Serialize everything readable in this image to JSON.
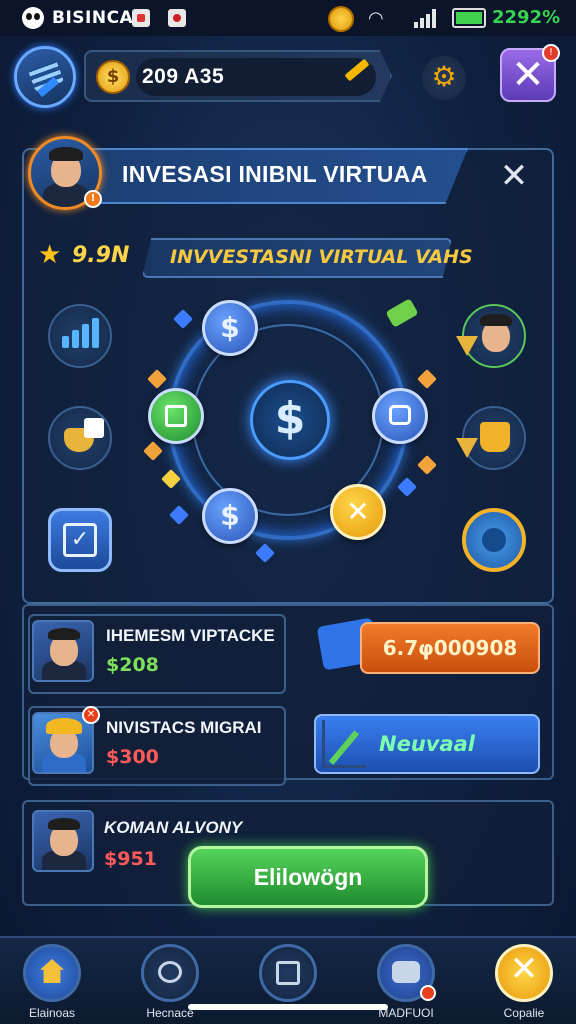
{
  "status_bar": {
    "carrier": "BISINCA",
    "battery_percent": "2292%",
    "battery_level": 1.0,
    "icons": [
      "panda-icon",
      "notification-icon",
      "gallery-icon",
      "coin-icon",
      "wifi-icon",
      "signal-icon",
      "battery-icon"
    ]
  },
  "top_bar": {
    "balance": "209 A35",
    "coin_symbol": "$",
    "settings_icon": "gear-icon",
    "close_symbol": "✕",
    "close_badge": "!"
  },
  "panel": {
    "title": "INVESASI INIBNL VIRTUAA",
    "close_symbol": "✕",
    "avatar_badge": "!",
    "rating_star": "★",
    "rating": "9.9N",
    "subtitle": "INVVESTASNI VIRTUAL VAHS",
    "hub_symbol": "$",
    "orbs": {
      "top_symbol": "$",
      "bottom_symbol": "$",
      "close_symbol": "✕"
    }
  },
  "offers": [
    {
      "name": "IHEMESM VIPTACKE",
      "price": "$208",
      "price_color": "#7ee05a",
      "action": "6.7φ000908",
      "action_color": "#e8621c",
      "badge": ""
    },
    {
      "name": "NIVISTACS MIGRAI",
      "price": "$300",
      "price_color": "#ff5a5a",
      "action": "Neuvaal",
      "action_color": "#2f6fe0",
      "badge": "✕"
    },
    {
      "name": "KOMAN ALVONY",
      "price": "$951",
      "price_color": "#ff5a5a",
      "action": "Elilowögn",
      "action_color": "#2fb33c",
      "badge": ""
    }
  ],
  "bottom_nav": [
    {
      "label": "Elainoas",
      "icon": "home-icon"
    },
    {
      "label": "Hecnace",
      "icon": "chat-icon"
    },
    {
      "label": "",
      "icon": "clapper-icon"
    },
    {
      "label": "MADFUOI",
      "icon": "controller-icon"
    },
    {
      "label": "Copalie",
      "icon": "close-icon"
    }
  ]
}
